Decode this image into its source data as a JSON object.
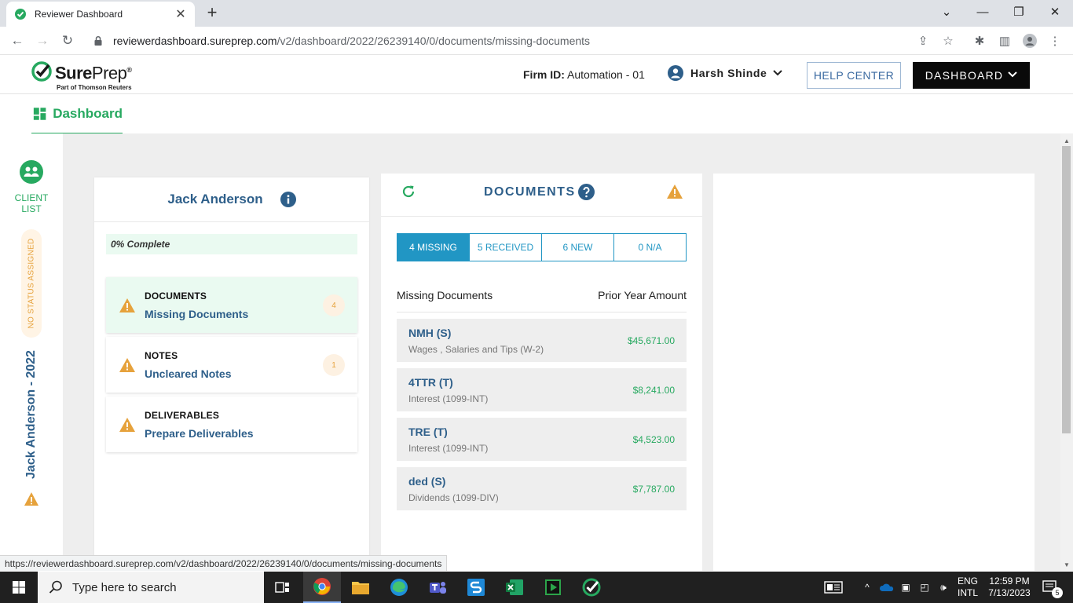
{
  "browser": {
    "tab_title": "Reviewer Dashboard",
    "tab_close": "✕",
    "new_tab": "+",
    "url_host": "reviewerdashboard.sureprep.com",
    "url_path": "/v2/dashboard/2022/26239140/0/documents/missing-documents",
    "status_url": "https://reviewerdashboard.sureprep.com/v2/dashboard/2022/26239140/0/documents/missing-documents"
  },
  "header": {
    "brand_bold": "Sure",
    "brand_light": "Prep",
    "brand_reg": "®",
    "brand_sub": "Part of Thomson Reuters",
    "firm_label": "Firm ID:",
    "firm_value": "Automation - 01",
    "user_name": "Harsh Shinde",
    "help_label": "HELP CENTER",
    "dashboard_label": "DASHBOARD"
  },
  "subnav": {
    "label": "Dashboard"
  },
  "rail": {
    "client_list_1": "CLIENT",
    "client_list_2": "LIST",
    "status": "NO STATUS ASSIGNED",
    "client_year": "Jack Anderson - 2022"
  },
  "client": {
    "name": "Jack Anderson",
    "progress": "0% Complete",
    "tasks": [
      {
        "title": "DOCUMENTS",
        "subtitle": "Missing Documents",
        "count": "4"
      },
      {
        "title": "NOTES",
        "subtitle": "Uncleared Notes",
        "count": "1"
      },
      {
        "title": "DELIVERABLES",
        "subtitle": "Prepare Deliverables"
      }
    ]
  },
  "documents": {
    "title": "DOCUMENTS",
    "tabs": [
      "4 MISSING",
      "5 RECEIVED",
      "6 NEW",
      "0 N/A"
    ],
    "col_left": "Missing Documents",
    "col_right": "Prior Year Amount",
    "rows": [
      {
        "code": "NMH (S)",
        "desc": "Wages , Salaries and Tips (W-2)",
        "amount": "$45,671.00"
      },
      {
        "code": "4TTR (T)",
        "desc": "Interest (1099-INT)",
        "amount": "$8,241.00"
      },
      {
        "code": "TRE (T)",
        "desc": "Interest (1099-INT)",
        "amount": "$4,523.00"
      },
      {
        "code": "ded (S)",
        "desc": "Dividends (1099-DIV)",
        "amount": "$7,787.00"
      }
    ]
  },
  "taskbar": {
    "search_placeholder": "Type here to search",
    "lang_1": "ENG",
    "lang_2": "INTL",
    "time": "12:59 PM",
    "date": "7/13/2023",
    "notif_count": "5"
  },
  "colors": {
    "accent_green": "#27a960",
    "accent_blue": "#2196c4",
    "title_blue": "#2e5f8a",
    "warning": "#e6a23c"
  }
}
